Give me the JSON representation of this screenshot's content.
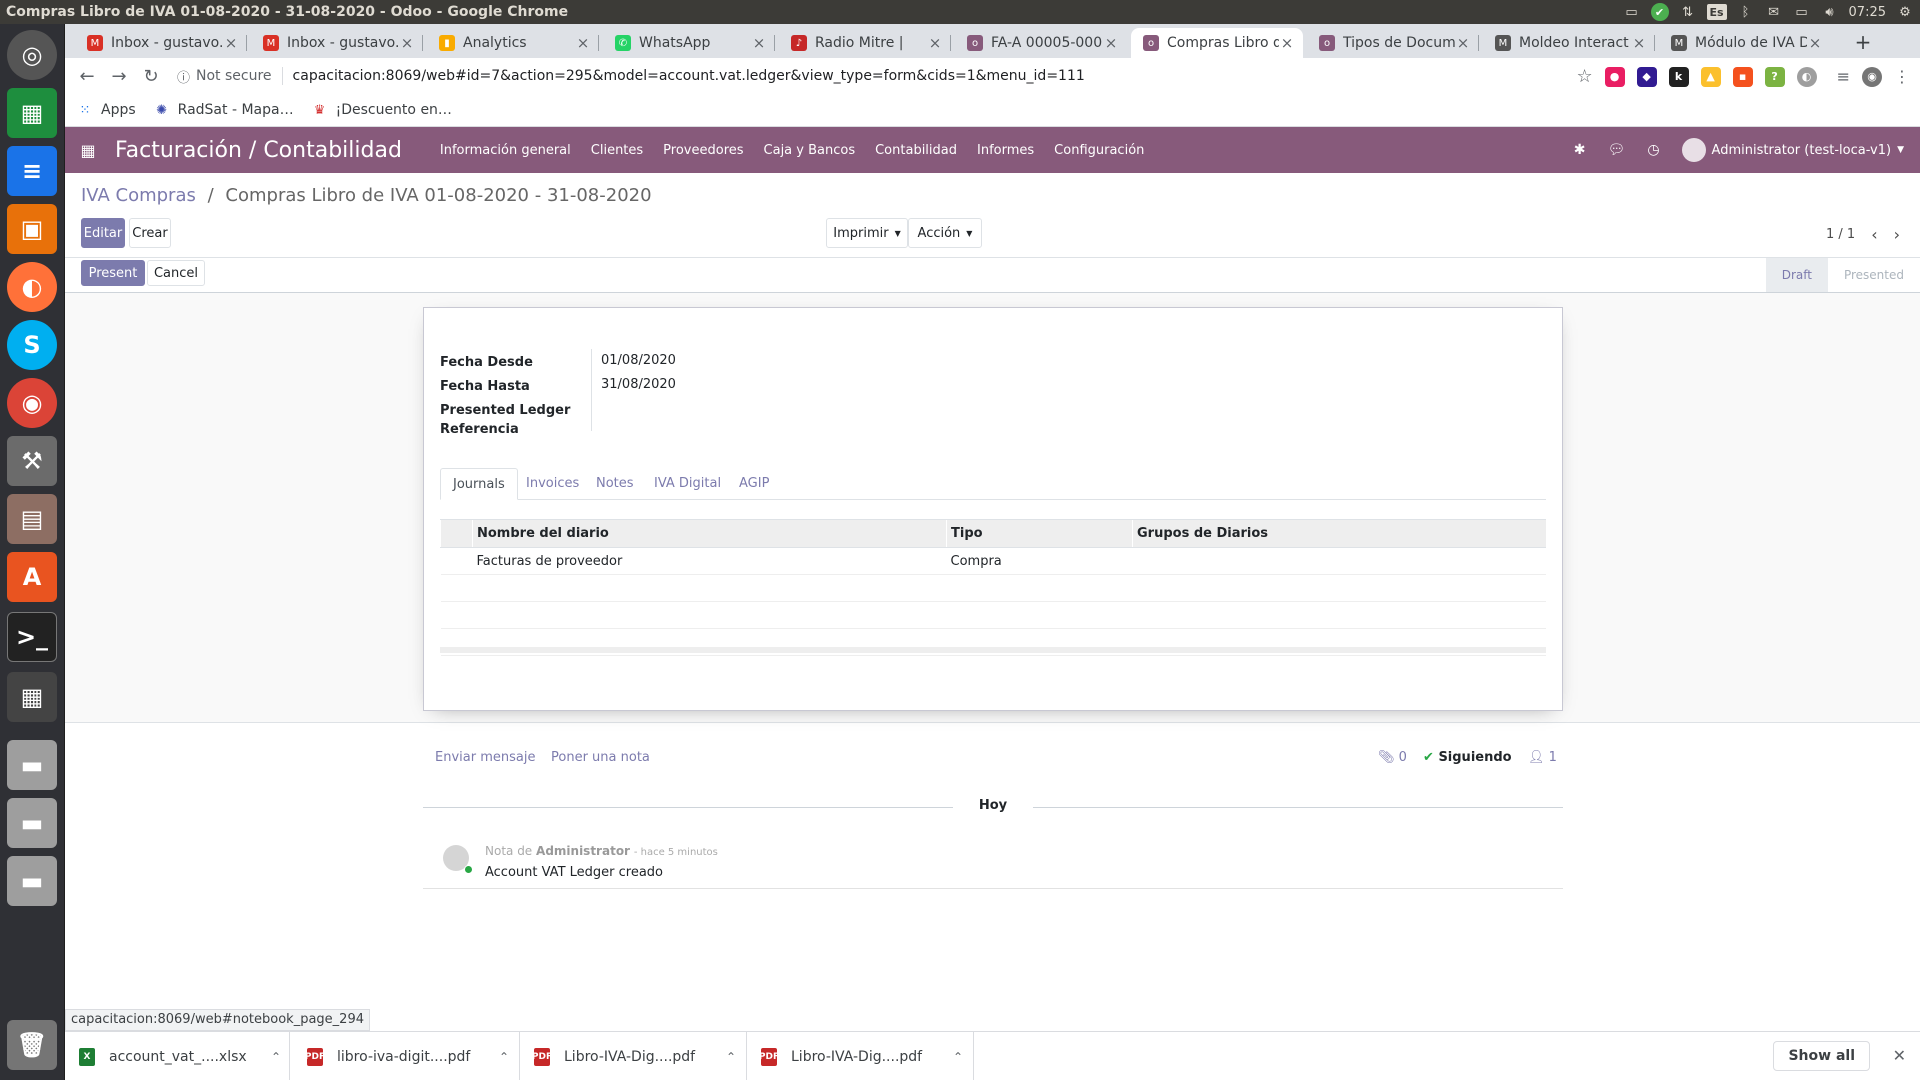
{
  "os": {
    "window_title": "Compras Libro de IVA 01-08-2020 - 31-08-2020 - Odoo - Google Chrome",
    "keyboard_layout": "Es",
    "clock": "07:25"
  },
  "browser": {
    "tabs": [
      {
        "title": "Inbox - gustavo.",
        "fav_color": "#d93025",
        "fav": "M"
      },
      {
        "title": "Inbox - gustavo.",
        "fav_color": "#d93025",
        "fav": "M"
      },
      {
        "title": "Analytics",
        "fav_color": "#f9ab00",
        "fav": "▮"
      },
      {
        "title": "WhatsApp",
        "fav_color": "#25d366",
        "fav": "✆"
      },
      {
        "title": "Radio Mitre |",
        "fav_color": "#c62828",
        "fav": "♪"
      },
      {
        "title": "FA-A 00005-0000",
        "fav_color": "#875a7b",
        "fav": "o"
      },
      {
        "title": "Compras Libro d",
        "fav_color": "#875a7b",
        "fav": "o"
      },
      {
        "title": "Tipos de Docum",
        "fav_color": "#875a7b",
        "fav": "o"
      },
      {
        "title": "Moldeo Interact",
        "fav_color": "#555555",
        "fav": "M"
      },
      {
        "title": "Módulo de IVA D",
        "fav_color": "#555555",
        "fav": "M"
      }
    ],
    "active_tab": 6,
    "new_tab": "+",
    "security_label": "Not secure",
    "url": "capacitacion:8069/web#id=7&action=295&model=account.vat.ledger&view_type=form&cids=1&menu_id=111",
    "bookmarks": [
      {
        "label": "Apps",
        "icon": "apps-grid-icon"
      },
      {
        "label": "RadSat - Mapa…",
        "icon": "radsat-icon"
      },
      {
        "label": "¡Descuento en…",
        "icon": "promo-icon"
      }
    ],
    "hover_url": "capacitacion:8069/web#notebook_page_294",
    "downloads": [
      {
        "name": "account_vat_....xlsx",
        "type_color": "#1e7e34",
        "type": "X"
      },
      {
        "name": "libro-iva-digit....pdf",
        "type_color": "#c62828",
        "type": "PDF"
      },
      {
        "name": "Libro-IVA-Dig....pdf",
        "type_color": "#c62828",
        "type": "PDF"
      },
      {
        "name": "Libro-IVA-Dig....pdf",
        "type_color": "#c62828",
        "type": "PDF"
      }
    ],
    "show_all": "Show all"
  },
  "odoo": {
    "app_title": "Facturación / Contabilidad",
    "menu": [
      "Información general",
      "Clientes",
      "Proveedores",
      "Caja y Bancos",
      "Contabilidad",
      "Informes",
      "Configuración"
    ],
    "user": "Administrator (test-loca-v1)",
    "breadcrumb": {
      "parent": "IVA Compras",
      "separator": "/",
      "current": "Compras Libro de IVA 01-08-2020 - 31-08-2020"
    },
    "buttons": {
      "edit": "Editar",
      "create": "Crear",
      "print": "Imprimir",
      "action": "Acción",
      "present": "Present",
      "cancel": "Cancel"
    },
    "pager": "1 / 1",
    "status_steps": [
      "Draft",
      "Presented"
    ],
    "current_status": "Draft",
    "fields": [
      {
        "label": "Fecha Desde",
        "value": "01/08/2020"
      },
      {
        "label": "Fecha Hasta",
        "value": "31/08/2020"
      },
      {
        "label": "Presented Ledger Referencia",
        "value": ""
      }
    ],
    "notebook_tabs": [
      "Journals",
      "Invoices",
      "Notes",
      "IVA Digital",
      "AGIP"
    ],
    "active_notebook_tab": "Journals",
    "journals_table": {
      "headers": [
        "Nombre del diario",
        "Tipo",
        "Grupos de Diarios"
      ],
      "rows": [
        [
          "Facturas de proveedor",
          "Compra",
          ""
        ]
      ]
    },
    "chatter": {
      "send_message": "Enviar mensaje",
      "log_note": "Poner una nota",
      "attachments_count": "0",
      "following": "Siguiendo",
      "followers_count": "1",
      "today": "Hoy",
      "message": {
        "prefix": "Nota de",
        "author": "Administrator",
        "time": "- hace 5 minutos",
        "body": "Account VAT Ledger creado"
      }
    }
  }
}
